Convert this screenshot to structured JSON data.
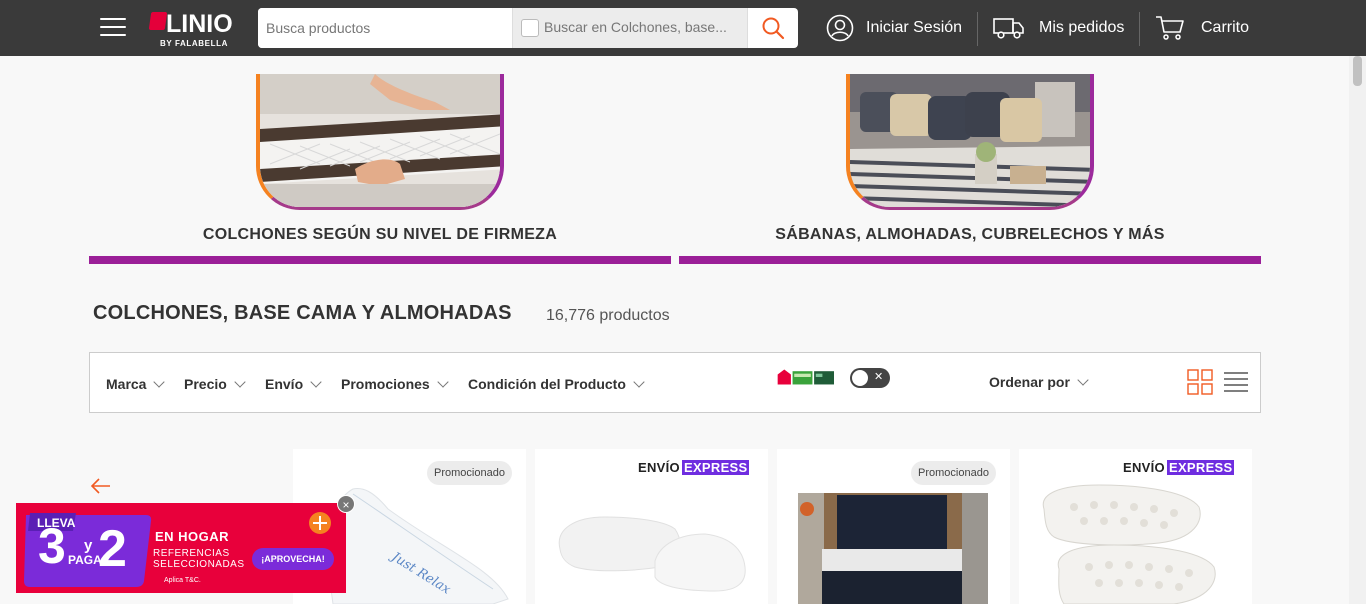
{
  "header": {
    "menu_icon": "hamburger-menu-icon",
    "logo_text": "LINIO",
    "logo_sub": "BY FALABELLA",
    "search_placeholder": "Busca productos",
    "scope_label": "Buscar en Colchones, base...",
    "search_icon": "search-icon",
    "login_label": "Iniciar Sesión",
    "orders_label": "Mis pedidos",
    "cart_label": "Carrito",
    "brand_color": "#3a3a3a",
    "accent_color": "#f15a22"
  },
  "categories": [
    {
      "label": "COLCHONES SEGÚN SU NIVEL DE FIRMEZA"
    },
    {
      "label": "SÁBANAS, ALMOHADAS, CUBRELECHOS Y MÁS"
    }
  ],
  "listing": {
    "title": "COLCHONES, BASE CAMA Y ALMOHADAS",
    "count": "16,776 productos"
  },
  "filters": {
    "items": [
      "Marca",
      "Precio",
      "Envío",
      "Promociones",
      "Condición del Producto"
    ],
    "card_logos": [
      "Única",
      "CMR",
      "Banco Falabella"
    ],
    "toggle_state": "off",
    "order_label": "Ordenar por"
  },
  "products": [
    {
      "badge": "Promocionado",
      "shipping": "",
      "image": "body-pillow"
    },
    {
      "badge": "",
      "shipping": "ENVÍO",
      "shipping_express": "EXPRESS",
      "image": "memory-foam-pillows"
    },
    {
      "badge": "Promocionado",
      "shipping": "",
      "image": "bed-with-headboard"
    },
    {
      "badge": "",
      "shipping": "ENVÍO",
      "shipping_express": "EXPRESS",
      "image": "egg-crate-pillows"
    }
  ],
  "banner": {
    "lleva": "LLEVA",
    "num3": "3",
    "y": "y",
    "paga": "PAGA",
    "num2": "2",
    "line1": "EN HOGAR",
    "line2": "REFERENCIAS",
    "line3": "SELECCIONADAS",
    "cta": "¡APROVECHA!",
    "terms": "Aplica T&C.",
    "close": "×"
  }
}
